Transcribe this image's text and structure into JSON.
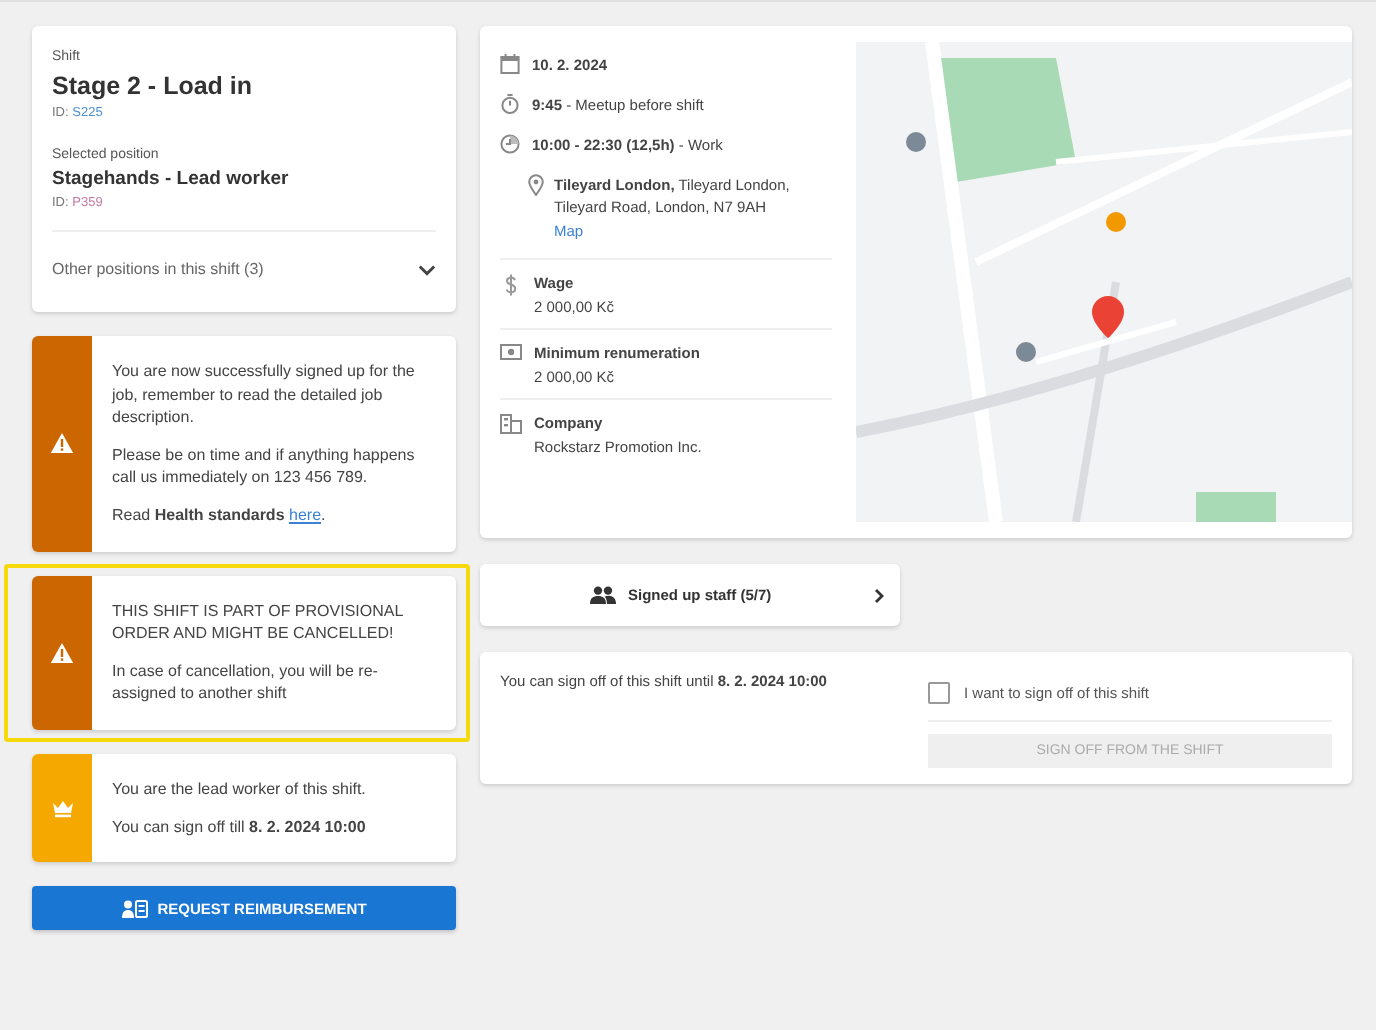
{
  "shift": {
    "label": "Shift",
    "title": "Stage 2 - Load in",
    "id_prefix": "ID:",
    "id": "S225"
  },
  "position": {
    "label": "Selected position",
    "title": "Stagehands - Lead worker",
    "id_prefix": "ID:",
    "id": "P359"
  },
  "other_positions": {
    "label": "Other positions in this shift (3)",
    "expanded": false
  },
  "notices": [
    {
      "kind": "warning",
      "highlighted": false,
      "paragraphs": [
        {
          "text": "You are now successfully signed up for the job, remember to read the detailed job description."
        },
        {
          "text": "Please be on time and if anything happens call us immediately on 123 456 789."
        },
        {
          "text": "Read **Health standards** ",
          "link": "here",
          "after": "."
        }
      ]
    },
    {
      "kind": "warning",
      "highlighted": true,
      "paragraphs": [
        {
          "text": "THIS SHIFT IS PART OF PROVISIONAL ORDER AND MIGHT BE CANCELLED!"
        },
        {
          "text": "In case of cancellation, you will be re-assigned to another shift"
        }
      ]
    },
    {
      "kind": "lead",
      "highlighted": false,
      "paragraphs": [
        {
          "text": "You are the lead worker of this shift."
        },
        {
          "text": "You can sign off till **8. 2. 2024 10:00**"
        }
      ]
    }
  ],
  "reimburse_button": "REQUEST REIMBURSEMENT",
  "details": {
    "date": "10. 2. 2024",
    "schedule": [
      {
        "kind": "meetup",
        "time": "9:45",
        "text": " - Meetup before shift"
      },
      {
        "kind": "work",
        "time": "10:00 - 22:30 (12,5h)",
        "text": " - Work"
      }
    ],
    "location": {
      "name": "Tileyard London,",
      "address": " Tileyard London, Tileyard Road, London, N7 9AH",
      "link": "Map"
    },
    "info": [
      {
        "kind": "wage",
        "label": "Wage",
        "value": "2 000,00 Kč"
      },
      {
        "kind": "renumeration",
        "label": "Minimum renumeration",
        "value": "2 000,00 Kč"
      },
      {
        "kind": "company",
        "label": "Company",
        "value": "Rockstarz Promotion Inc."
      }
    ]
  },
  "staff_button": "Signed up staff (5/7)",
  "sign_off": {
    "text": "You can sign off of this shift until **8. 2. 2024 10:00**",
    "checkbox": {
      "label": "I want to sign off of this shift",
      "checked": false
    },
    "button": {
      "label": "SIGN OFF FROM THE SHIFT",
      "disabled": true
    }
  }
}
